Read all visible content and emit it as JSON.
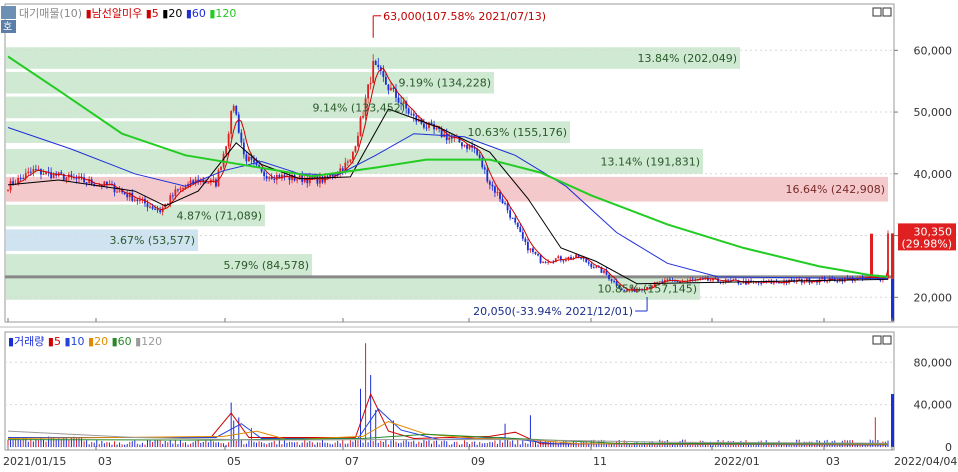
{
  "price_legend": {
    "label": "대기매물(10)",
    "stock": "남선알미우",
    "ma_labels": [
      "5",
      "20",
      "60",
      "120"
    ],
    "ma_colors": [
      "#d00000",
      "#000000",
      "#1f2fd8",
      "#22cc22"
    ]
  },
  "volume_legend": {
    "label": "거래량",
    "ma_labels": [
      "5",
      "10",
      "20",
      "60",
      "120"
    ],
    "ma_colors": [
      "#d00000",
      "#2244dd",
      "#e08a00",
      "#2a8a2a",
      "#9a9a9a"
    ]
  },
  "side_button": "호",
  "colors": {
    "up": "#e02020",
    "down": "#1a2fd8",
    "zone": "#cfe9d2",
    "zone_current": "#f4c9cb",
    "zone_low": "#cfe3f1",
    "zone_text": "#2a5a2a",
    "grid": "#d8d8d8",
    "ref_line": "#888888"
  },
  "chart_data": [
    {
      "type": "candlestick",
      "title": "남선알미우",
      "x_labels": [
        "2021/01/15",
        "03",
        "05",
        "07",
        "09",
        "11",
        "2022/01",
        "03",
        "2022/04/04"
      ],
      "y_ticks": [
        20000,
        30000,
        40000,
        50000,
        60000
      ],
      "y_tick_labels": [
        "20,000",
        "30,000",
        "40,000",
        "50,000",
        "60,000"
      ],
      "ylim": [
        16000,
        67500
      ],
      "grid": true,
      "high_marker": {
        "label": "63,000(107.58% 2021/07/13)",
        "value": 63000
      },
      "low_marker": {
        "label": "20,050(-33.94% 2021/12/01)",
        "value": 20050
      },
      "current_price": {
        "price": "30,350",
        "change": "(29.98%)",
        "value": 30350
      },
      "reference_line": 23300,
      "supply_zones": [
        {
          "low": 57000,
          "high": 60500,
          "label": "13.84% (202,049)",
          "current": false
        },
        {
          "low": 53000,
          "high": 56500,
          "label": "9.19% (134,228)",
          "current": false
        },
        {
          "low": 49000,
          "high": 52500,
          "label": "9.14% (133,452)",
          "current": false
        },
        {
          "low": 45000,
          "high": 48500,
          "label": "10.63% (155,176)",
          "current": false
        },
        {
          "low": 40000,
          "high": 44000,
          "label": "13.14% (191,831)",
          "current": false
        },
        {
          "low": 35500,
          "high": 39500,
          "label": "16.64% (242,908)",
          "current": true
        },
        {
          "low": 31500,
          "high": 35000,
          "label": "4.87% (71,089)",
          "current": false
        },
        {
          "low": 27500,
          "high": 31000,
          "label": "3.67% (53,577)",
          "current": false
        },
        {
          "low": 23500,
          "high": 27000,
          "label": "5.79% (84,578)",
          "current": false
        },
        {
          "low": 19600,
          "high": 23200,
          "label": "10.85% (157,145)",
          "current": false
        }
      ],
      "price_anchors": [
        {
          "i": 0,
          "v": 38000
        },
        {
          "i": 10,
          "v": 40500
        },
        {
          "i": 30,
          "v": 38800
        },
        {
          "i": 40,
          "v": 38000
        },
        {
          "i": 50,
          "v": 36000
        },
        {
          "i": 60,
          "v": 34000
        },
        {
          "i": 66,
          "v": 37000
        },
        {
          "i": 75,
          "v": 39000
        },
        {
          "i": 82,
          "v": 38500
        },
        {
          "i": 86,
          "v": 45000
        },
        {
          "i": 89,
          "v": 51500
        },
        {
          "i": 93,
          "v": 43000
        },
        {
          "i": 100,
          "v": 40000
        },
        {
          "i": 112,
          "v": 39300
        },
        {
          "i": 125,
          "v": 39000
        },
        {
          "i": 135,
          "v": 42000
        },
        {
          "i": 140,
          "v": 50000
        },
        {
          "i": 144,
          "v": 57500
        },
        {
          "i": 150,
          "v": 54000
        },
        {
          "i": 160,
          "v": 49000
        },
        {
          "i": 168,
          "v": 47000
        },
        {
          "i": 176,
          "v": 45500
        },
        {
          "i": 184,
          "v": 44000
        },
        {
          "i": 190,
          "v": 38500
        },
        {
          "i": 196,
          "v": 35000
        },
        {
          "i": 204,
          "v": 28500
        },
        {
          "i": 210,
          "v": 26000
        },
        {
          "i": 225,
          "v": 26500
        },
        {
          "i": 235,
          "v": 24000
        },
        {
          "i": 243,
          "v": 21000
        },
        {
          "i": 250,
          "v": 21500
        },
        {
          "i": 258,
          "v": 22500
        },
        {
          "i": 275,
          "v": 22800
        },
        {
          "i": 295,
          "v": 22300
        },
        {
          "i": 315,
          "v": 22700
        },
        {
          "i": 340,
          "v": 23100
        },
        {
          "i": 347,
          "v": 23300
        }
      ],
      "ma_overlays": [
        {
          "name": "20",
          "points": [
            [
              0,
              38200
            ],
            [
              20,
              39000
            ],
            [
              50,
              37200
            ],
            [
              62,
              34800
            ],
            [
              75,
              37200
            ],
            [
              90,
              45000
            ],
            [
              100,
              41500
            ],
            [
              115,
              39200
            ],
            [
              135,
              39500
            ],
            [
              150,
              50500
            ],
            [
              170,
              47500
            ],
            [
              190,
              43500
            ],
            [
              205,
              36000
            ],
            [
              218,
              28000
            ],
            [
              232,
              25800
            ],
            [
              248,
              22200
            ],
            [
              262,
              22300
            ],
            [
              347,
              22900
            ]
          ]
        },
        {
          "name": "60",
          "points": [
            [
              0,
              47500
            ],
            [
              25,
              44000
            ],
            [
              50,
              40000
            ],
            [
              70,
              38000
            ],
            [
              85,
              40500
            ],
            [
              100,
              42000
            ],
            [
              115,
              40000
            ],
            [
              130,
              39800
            ],
            [
              145,
              43000
            ],
            [
              160,
              46500
            ],
            [
              180,
              46000
            ],
            [
              200,
              43000
            ],
            [
              220,
              38000
            ],
            [
              240,
              30500
            ],
            [
              260,
              25500
            ],
            [
              280,
              23300
            ],
            [
              347,
              23000
            ]
          ]
        },
        {
          "name": "120",
          "points": [
            [
              0,
              59000
            ],
            [
              20,
              53500
            ],
            [
              45,
              46500
            ],
            [
              70,
              43000
            ],
            [
              95,
              41300
            ],
            [
              120,
              39600
            ],
            [
              145,
              41000
            ],
            [
              165,
              42300
            ],
            [
              190,
              42300
            ],
            [
              210,
              40200
            ],
            [
              230,
              36500
            ],
            [
              260,
              31800
            ],
            [
              290,
              28000
            ],
            [
              320,
              25000
            ],
            [
              340,
              23600
            ],
            [
              347,
              23300
            ]
          ]
        }
      ],
      "volume_overlays": [
        {
          "name": "5",
          "points": [
            [
              0,
              9000
            ],
            [
              80,
              9000
            ],
            [
              88,
              32000
            ],
            [
              95,
              9000
            ],
            [
              137,
              9000
            ],
            [
              143,
              50000
            ],
            [
              150,
              15000
            ],
            [
              160,
              8000
            ],
            [
              190,
              10000
            ],
            [
              200,
              14000
            ],
            [
              210,
              3000
            ],
            [
              347,
              2000
            ]
          ]
        },
        {
          "name": "10",
          "points": [
            [
              0,
              9000
            ],
            [
              82,
              9000
            ],
            [
              92,
              22000
            ],
            [
              100,
              8000
            ],
            [
              138,
              8000
            ],
            [
              146,
              36000
            ],
            [
              155,
              16000
            ],
            [
              170,
              7000
            ],
            [
              195,
              9000
            ],
            [
              215,
              3000
            ],
            [
              347,
              2000
            ]
          ]
        },
        {
          "name": "20",
          "points": [
            [
              0,
              8000
            ],
            [
              85,
              10000
            ],
            [
              98,
              15000
            ],
            [
              110,
              7000
            ],
            [
              140,
              10000
            ],
            [
              150,
              24000
            ],
            [
              165,
              12000
            ],
            [
              185,
              8000
            ],
            [
              205,
              7000
            ],
            [
              225,
              3000
            ],
            [
              347,
              2500
            ]
          ]
        },
        {
          "name": "60",
          "points": [
            [
              0,
              7000
            ],
            [
              80,
              6500
            ],
            [
              110,
              7500
            ],
            [
              140,
              8000
            ],
            [
              165,
              12000
            ],
            [
              200,
              8000
            ],
            [
              240,
              3500
            ],
            [
              347,
              3000
            ]
          ]
        },
        {
          "name": "120",
          "points": [
            [
              0,
              15000
            ],
            [
              50,
              9000
            ],
            [
              100,
              6500
            ],
            [
              150,
              7000
            ],
            [
              200,
              7000
            ],
            [
              260,
              4500
            ],
            [
              347,
              3500
            ]
          ]
        }
      ]
    },
    {
      "type": "bar",
      "title": "거래량",
      "y_ticks": [
        0,
        40000,
        80000
      ],
      "y_tick_labels": [
        "0",
        "40,000",
        "80,000"
      ],
      "ylim": [
        0,
        102000
      ],
      "volume_spikes": [
        {
          "i": 88,
          "v": 42000
        },
        {
          "i": 89,
          "v": 25000
        },
        {
          "i": 91,
          "v": 28000
        },
        {
          "i": 96,
          "v": 18000
        },
        {
          "i": 139,
          "v": 55000
        },
        {
          "i": 141,
          "v": 98000
        },
        {
          "i": 143,
          "v": 68000
        },
        {
          "i": 145,
          "v": 35000
        },
        {
          "i": 152,
          "v": 25000
        },
        {
          "i": 196,
          "v": 22000
        },
        {
          "i": 206,
          "v": 30000
        },
        {
          "i": 342,
          "v": 28000
        }
      ]
    }
  ]
}
